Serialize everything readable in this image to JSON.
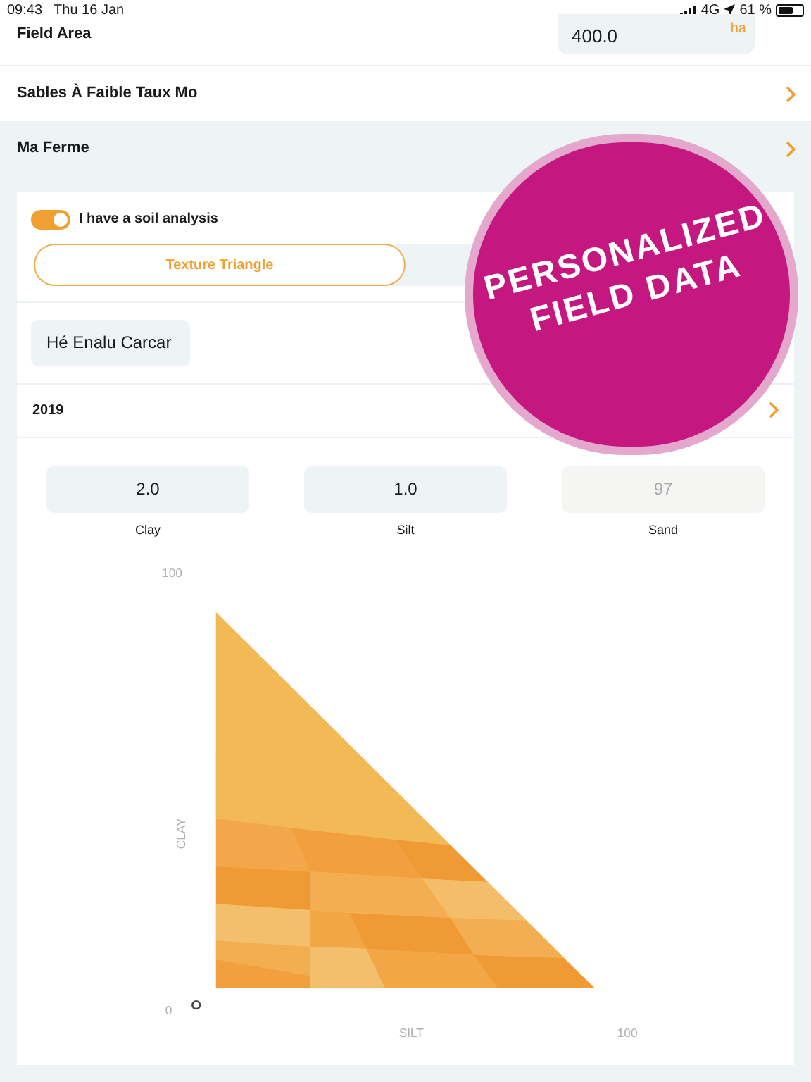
{
  "status_bar": {
    "time": "09:43",
    "date": "Thu 16 Jan",
    "network": "4G",
    "battery": "61 %"
  },
  "field_area": {
    "label": "Field Area",
    "value": "400.0",
    "unit": "ha"
  },
  "rows": [
    {
      "label": "Sables À Faible Taux Mo",
      "highlighted": false
    },
    {
      "label": "Ma Ferme",
      "highlighted": true
    }
  ],
  "soil_analysis": {
    "label": "I have a soil analysis",
    "on": true
  },
  "segments": [
    {
      "label": "Texture Triangle",
      "selected": true
    }
  ],
  "analysis_name": "Hé Enalu Carcar",
  "year": "2019",
  "fractions": [
    {
      "value": "2.0",
      "label": "Clay",
      "disabled": false
    },
    {
      "value": "1.0",
      "label": "Silt",
      "disabled": false
    },
    {
      "value": "97",
      "label": "Sand",
      "disabled": true
    }
  ],
  "chart": {
    "y_max": "100",
    "y_label": "CLAY",
    "origin": "0",
    "x_label": "SILT",
    "x_max": "100"
  },
  "badge": {
    "lines": [
      "PERSONALIZED",
      "FIELD DATA"
    ]
  }
}
